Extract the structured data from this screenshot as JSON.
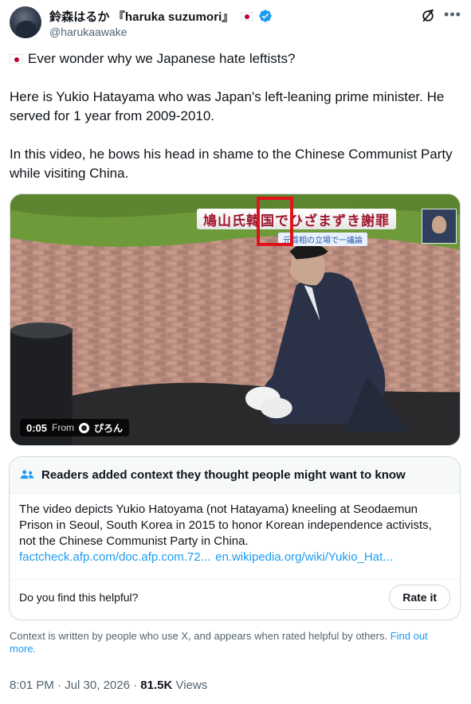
{
  "author": {
    "display_name": "鈴森はるか 『haruka suzumori』",
    "handle": "@harukaawake",
    "flag_icon": "japan-flag-icon",
    "verified_icon": "verified-badge-icon"
  },
  "actions": {
    "grok_icon": "grok-icon",
    "more_icon": "more-options-icon"
  },
  "tweet": {
    "paragraph1": "Ever wonder why we Japanese hate leftists?",
    "paragraph2": "Here is Yukio Hatayama who was Japan's left-leaning prime minister. He served for 1 year from 2009-2010.",
    "paragraph3": "In this video, he bows his head in shame to the Chinese Communist Party while visiting China."
  },
  "media": {
    "caption_main": "鳩山氏韓国でひざまずき謝罪",
    "caption_sub": "元首相の立場で一議論",
    "timestamp": "0:05",
    "from_label": "From",
    "channel_name": "ぴろん"
  },
  "community_note": {
    "header": "Readers added context they thought people might want to know",
    "body": "The video depicts Yukio Hatoyama (not Hatayama) kneeling at Seodaemun Prison in Seoul, South Korea in 2015 to honor Korean independence activists, not the Chinese Communist Party in China.",
    "link1": "factcheck.afp.com/doc.afp.com.72...",
    "link2": "en.wikipedia.org/wiki/Yukio_Hat...",
    "helpful_question": "Do you find this helpful?",
    "rate_button": "Rate it"
  },
  "context_footer": {
    "text": "Context is written by people who use X, and appears when rated helpful by others.",
    "link": "Find out more."
  },
  "meta": {
    "time": "8:01 PM",
    "separator": "·",
    "date": "Jul 30, 2026",
    "views_count": "81.5K",
    "views_label": "Views"
  },
  "colors": {
    "accent": "#1d9bf0",
    "text_primary": "#0f1419",
    "text_secondary": "#536471",
    "highlight_box": "#e0131b"
  }
}
